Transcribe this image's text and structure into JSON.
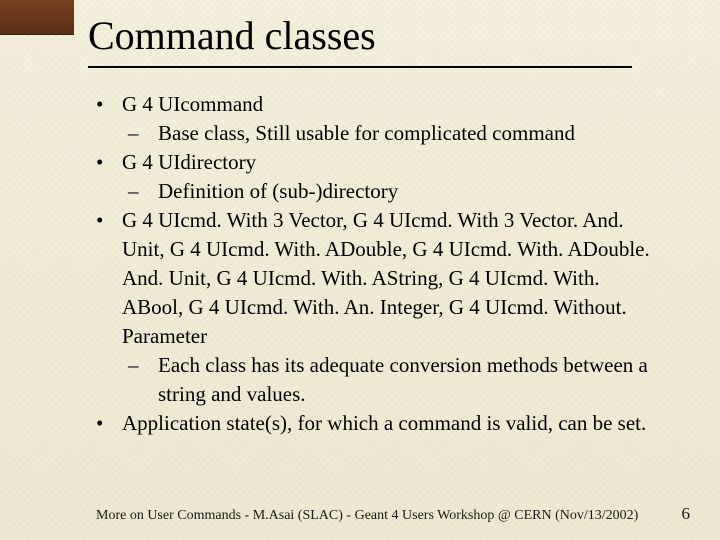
{
  "title": "Command classes",
  "bullets": [
    {
      "level": 1,
      "text": "G 4 UIcommand"
    },
    {
      "level": 2,
      "text": "Base class, Still usable for complicated command"
    },
    {
      "level": 1,
      "text": "G 4 UIdirectory"
    },
    {
      "level": 2,
      "text": "Definition of (sub-)directory"
    },
    {
      "level": 1,
      "text": "G 4 UIcmd. With 3 Vector, G 4 UIcmd. With 3 Vector. And. Unit, G 4 UIcmd. With. ADouble, G 4 UIcmd. With. ADouble. And. Unit, G 4 UIcmd. With. AString, G 4 UIcmd. With. ABool, G 4 UIcmd. With. An. Integer, G 4 UIcmd. Without. Parameter"
    },
    {
      "level": 2,
      "text": "Each class has its adequate conversion methods between a string and values."
    },
    {
      "level": 1,
      "text": "Application state(s), for which a command is valid, can be set."
    }
  ],
  "footer": {
    "text": "More on User Commands - M.Asai (SLAC) - Geant 4 Users Workshop @ CERN (Nov/13/2002)",
    "page": "6"
  }
}
